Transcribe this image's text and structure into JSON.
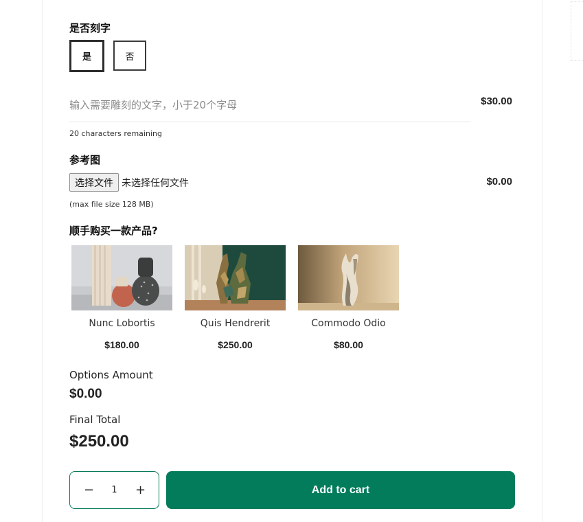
{
  "engraving": {
    "label": "是否刻字",
    "options": [
      "是",
      "否"
    ],
    "selected": "是",
    "input_placeholder": "输入需要雕刻的文字，小于20个字母",
    "price": "$30.00",
    "remaining_note": "20 characters remaining"
  },
  "reference_image": {
    "label": "参考图",
    "button_label": "选择文件",
    "status": "未选择任何文件",
    "price": "$0.00",
    "note": "(max file size 128 MB)"
  },
  "upsell": {
    "label": "顺手购买一款产品?",
    "products": [
      {
        "name": "Nunc Lobortis",
        "price": "$180.00"
      },
      {
        "name": "Quis Hendrerit",
        "price": "$250.00"
      },
      {
        "name": "Commodo Odio",
        "price": "$80.00"
      }
    ]
  },
  "summary": {
    "options_label": "Options Amount",
    "options_value": "$0.00",
    "final_label": "Final Total",
    "final_value": "$250.00"
  },
  "cart": {
    "quantity": "1",
    "minus_symbol": "−",
    "plus_symbol": "+",
    "button_label": "Add to cart"
  },
  "colors": {
    "accent": "#027c5b",
    "border_dark": "#2d2d2d"
  }
}
